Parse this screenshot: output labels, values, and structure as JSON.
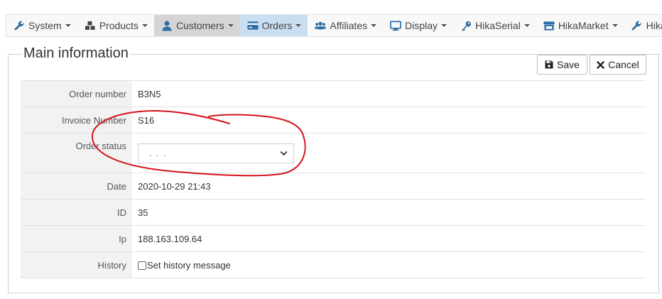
{
  "nav": {
    "items": [
      {
        "label": "System",
        "icon": "wrench-icon"
      },
      {
        "label": "Products",
        "icon": "cubes-icon"
      },
      {
        "label": "Customers",
        "icon": "user-icon"
      },
      {
        "label": "Orders",
        "icon": "credit-card-icon"
      },
      {
        "label": "Affiliates",
        "icon": "users-icon"
      },
      {
        "label": "Display",
        "icon": "desktop-icon"
      },
      {
        "label": "HikaSerial",
        "icon": "key-icon"
      },
      {
        "label": "HikaMarket",
        "icon": "store-icon"
      },
      {
        "label": "HikaA",
        "icon": "wrench-icon"
      }
    ]
  },
  "section": {
    "title": "Main information"
  },
  "toolbar": {
    "save_label": "Save",
    "cancel_label": "Cancel"
  },
  "fields": {
    "order_number": {
      "label": "Order number",
      "value": "B3N5"
    },
    "invoice_number": {
      "label": "Invoice Number",
      "value": "S16"
    },
    "order_status": {
      "label": "Order status",
      "selected": "   ,   ,   ,"
    },
    "date": {
      "label": "Date",
      "value": "2020-10-29 21:43"
    },
    "id": {
      "label": "ID",
      "value": "35"
    },
    "ip": {
      "label": "Ip",
      "value": "188.163.109.64"
    },
    "history": {
      "label": "History",
      "checkbox_label": "Set history message"
    }
  },
  "colors": {
    "annotation": "#d4141a",
    "selected_tab": "#c9def0",
    "active_tab": "#d5d5d5",
    "icon_blue": "#2e6da4"
  }
}
